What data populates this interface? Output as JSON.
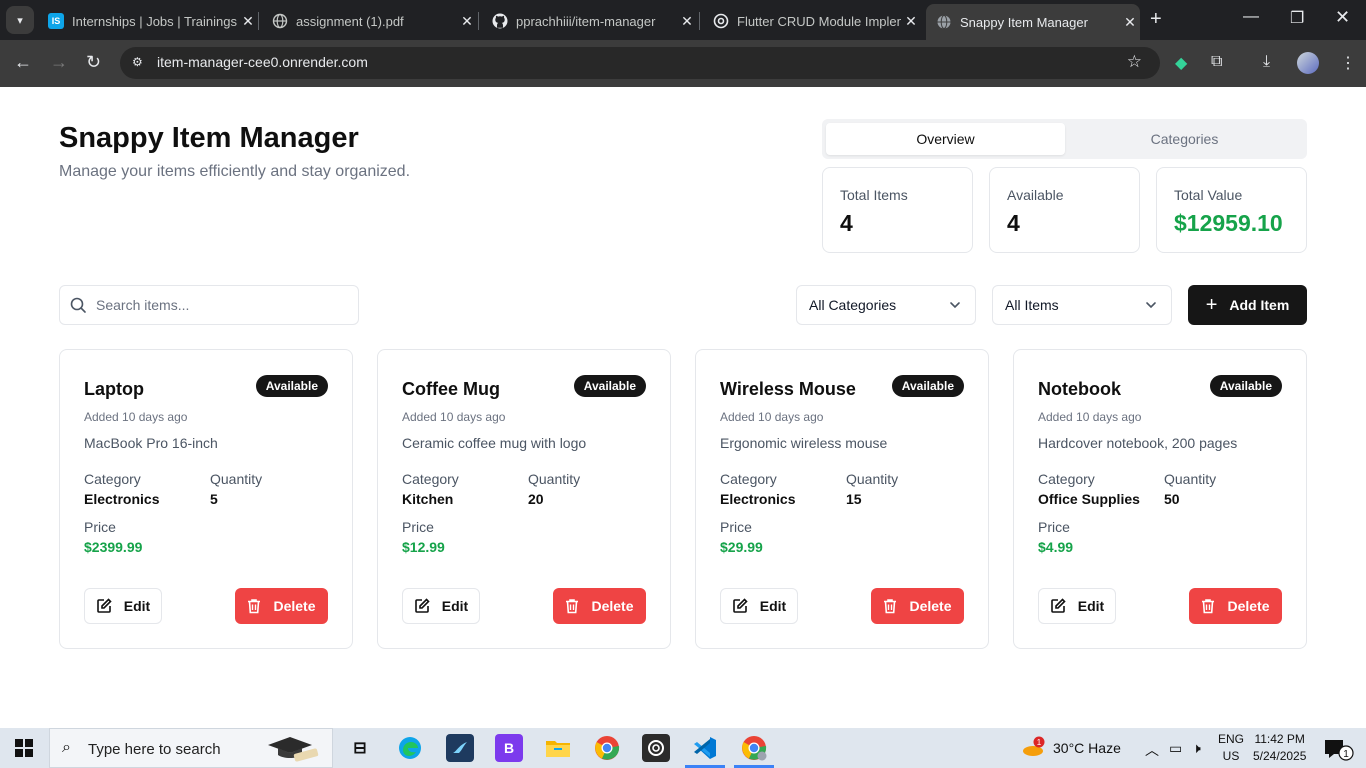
{
  "browser": {
    "tabs": [
      {
        "title": "Internships | Jobs | Trainings",
        "favicon": "internshala-icon",
        "active": false
      },
      {
        "title": "assignment (1).pdf",
        "favicon": "globe-icon",
        "active": false
      },
      {
        "title": "pprachhiii/item-manager",
        "favicon": "github-icon",
        "active": false
      },
      {
        "title": "Flutter CRUD Module Implem",
        "favicon": "openai-icon",
        "active": false
      },
      {
        "title": "Snappy Item Manager",
        "favicon": "globe-icon",
        "active": true
      }
    ],
    "url": "item-manager-cee0.onrender.com"
  },
  "header": {
    "title": "Snappy Item Manager",
    "subtitle": "Manage your items efficiently and stay organized."
  },
  "view_tabs": [
    {
      "label": "Overview",
      "selected": true
    },
    {
      "label": "Categories",
      "selected": false
    }
  ],
  "stats": [
    {
      "label": "Total Items",
      "value": "4"
    },
    {
      "label": "Available",
      "value": "4"
    },
    {
      "label": "Total Value",
      "value": "$12959.10",
      "color": "#16a34a"
    }
  ],
  "toolbar": {
    "search_placeholder": "Search items...",
    "category_filter": "All Categories",
    "status_filter": "All Items",
    "add_label": "Add Item"
  },
  "labels": {
    "category": "Category",
    "quantity": "Quantity",
    "price": "Price",
    "edit": "Edit",
    "delete": "Delete"
  },
  "items": [
    {
      "name": "Laptop",
      "status": "Available",
      "added": "Added 10 days ago",
      "description": "MacBook Pro 16-inch",
      "category": "Electronics",
      "quantity": "5",
      "price": "$2399.99"
    },
    {
      "name": "Coffee Mug",
      "status": "Available",
      "added": "Added 10 days ago",
      "description": "Ceramic coffee mug with logo",
      "category": "Kitchen",
      "quantity": "20",
      "price": "$12.99"
    },
    {
      "name": "Wireless Mouse",
      "status": "Available",
      "added": "Added 10 days ago",
      "description": "Ergonomic wireless mouse",
      "category": "Electronics",
      "quantity": "15",
      "price": "$29.99"
    },
    {
      "name": "Notebook",
      "status": "Available",
      "added": "Added 10 days ago",
      "description": "Hardcover notebook, 200 pages",
      "category": "Office Supplies",
      "quantity": "50",
      "price": "$4.99"
    }
  ],
  "taskbar": {
    "search_text": "Type here to search",
    "weather": "30°C  Haze",
    "weather_badge": "1",
    "lang_top": "ENG",
    "lang_bottom": "US",
    "time": "11:42 PM",
    "date": "5/24/2025",
    "notifications": "1"
  },
  "colors": {
    "accent_green": "#16a34a",
    "danger": "#ef4444",
    "primary_dark": "#161616"
  }
}
